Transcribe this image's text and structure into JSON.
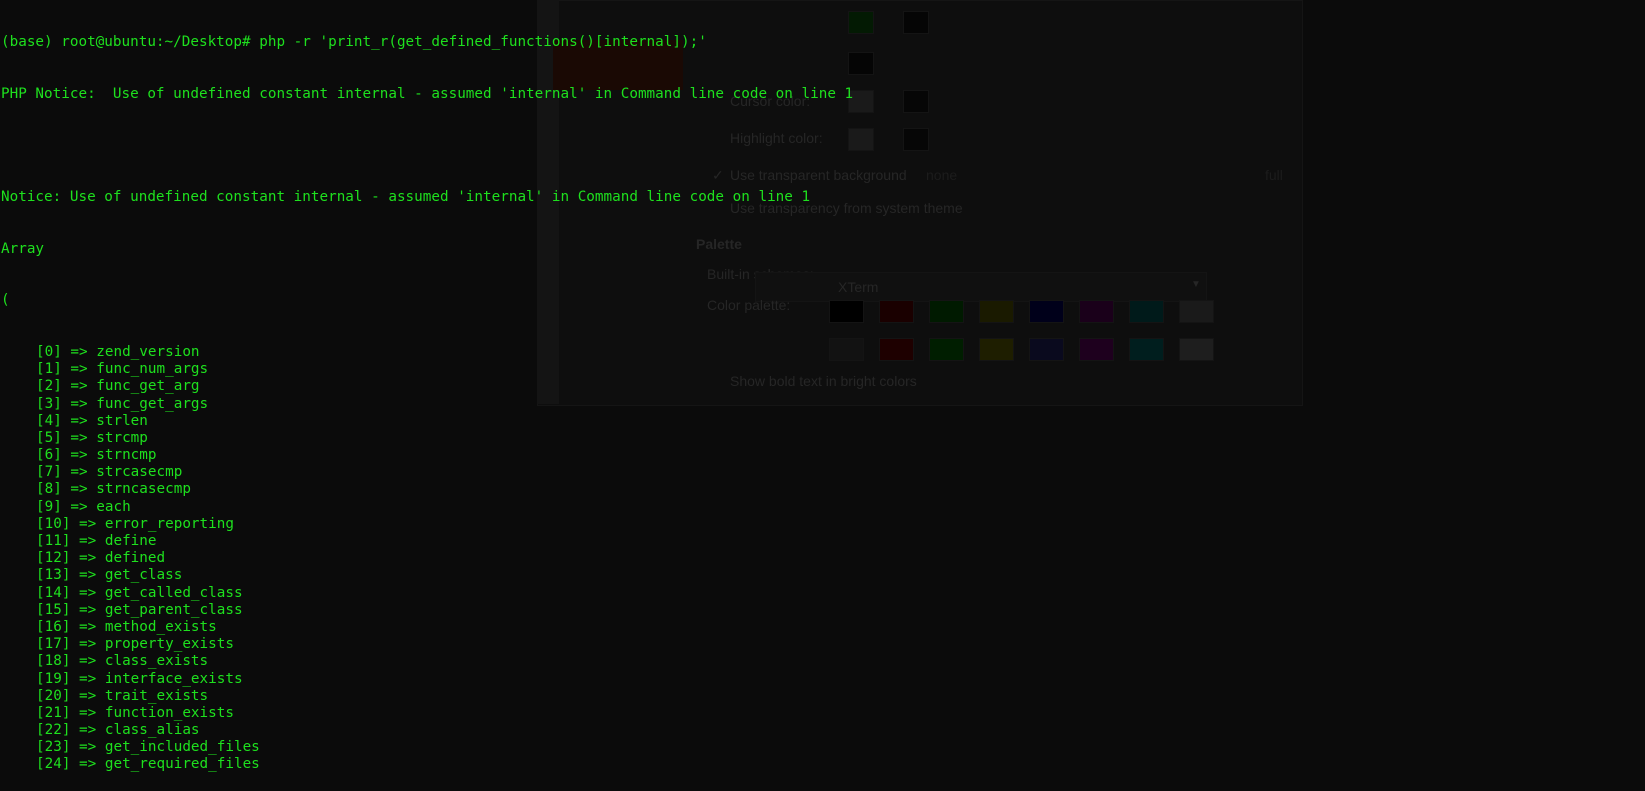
{
  "terminal": {
    "prompt": "(base) root@ubuntu:~/Desktop# php -r 'print_r(get_defined_functions()[internal]);'",
    "notice1": "PHP Notice:  Use of undefined constant internal - assumed 'internal' in Command line code on line 1",
    "notice2": "Notice: Use of undefined constant internal - assumed 'internal' in Command line code on line 1",
    "array_label": "Array",
    "open_paren": "(",
    "entries": [
      "[0] => zend_version",
      "[1] => func_num_args",
      "[2] => func_get_arg",
      "[3] => func_get_args",
      "[4] => strlen",
      "[5] => strcmp",
      "[6] => strncmp",
      "[7] => strcasecmp",
      "[8] => strncasecmp",
      "[9] => each",
      "[10] => error_reporting",
      "[11] => define",
      "[12] => defined",
      "[13] => get_class",
      "[14] => get_called_class",
      "[15] => get_parent_class",
      "[16] => method_exists",
      "[17] => property_exists",
      "[18] => class_exists",
      "[19] => interface_exists",
      "[20] => trait_exists",
      "[21] => function_exists",
      "[22] => class_alias",
      "[23] => get_included_files",
      "[24] => get_required_files"
    ],
    "text_color": "#1ee01e"
  },
  "background_dialog": {
    "cursor_color": "Cursor color:",
    "highlight_color": "Highlight color:",
    "transparent_bg": "Use transparent background",
    "transparent_none": "none",
    "transparent_full": "full",
    "system_transparency": "Use transparency from system theme",
    "palette_heading": "Palette",
    "schemes_label": "Built-in schemes:",
    "schemes_value": "XTerm",
    "palette_label": "Color palette:",
    "bold_bright": "Show bold text in bright colors",
    "palette_row1": [
      "#000000",
      "#1a0000",
      "#001a00",
      "#1a1a00",
      "#00001a",
      "#1a001a",
      "#001a1a",
      "#1a1a1a"
    ],
    "palette_row2": [
      "#121212",
      "#1e0000",
      "#001e00",
      "#1e1e00",
      "#0a0a1e",
      "#1e001e",
      "#001e1e",
      "#1e1e1e"
    ]
  }
}
